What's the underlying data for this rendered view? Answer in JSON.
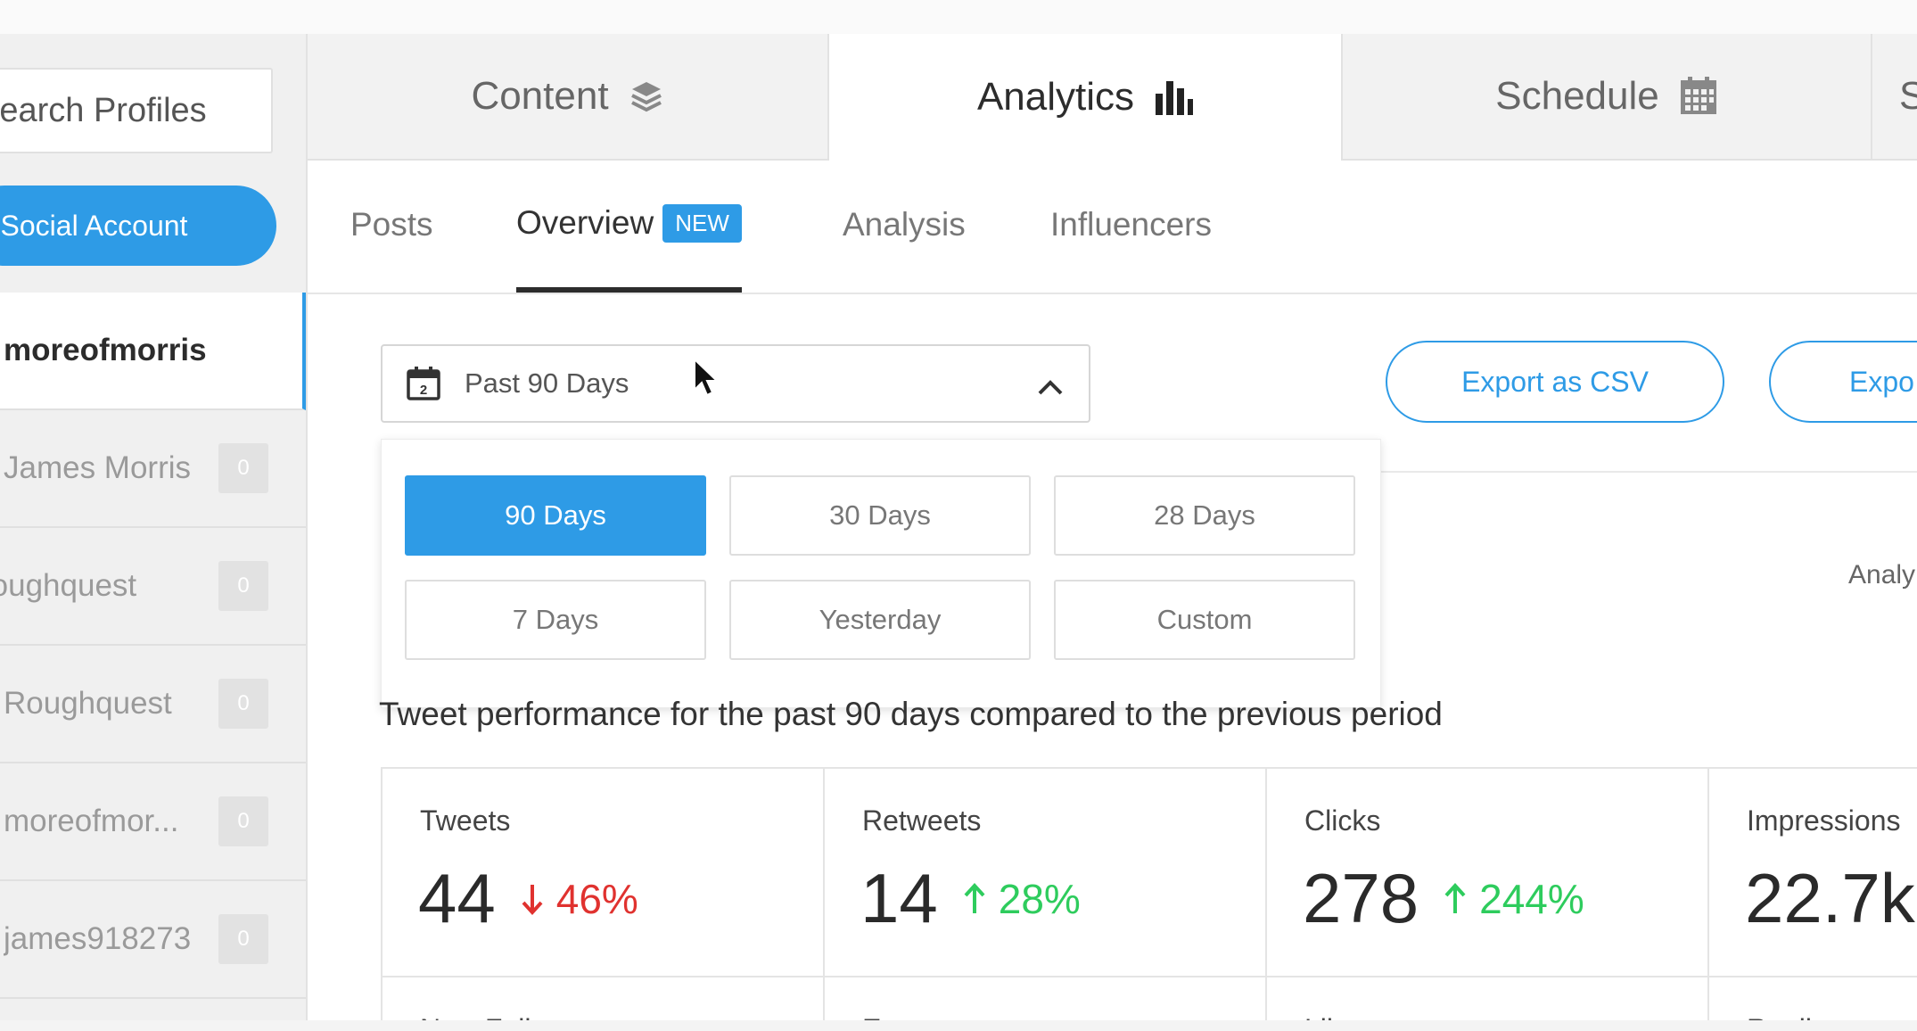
{
  "sidebar": {
    "search_placeholder": "Search Profiles",
    "add_button": "Add a Social Account",
    "profiles": [
      {
        "name": "moreofmorris",
        "badge": ""
      },
      {
        "name": "James Morris",
        "badge": "0"
      },
      {
        "name": "roughquest",
        "badge": "0"
      },
      {
        "name": "Roughquest",
        "badge": "0"
      },
      {
        "name": "moreofmor...",
        "badge": "0"
      },
      {
        "name": "james918273",
        "badge": "0"
      }
    ]
  },
  "topnav": {
    "tabs": [
      {
        "label": "Content",
        "icon": "layers-icon"
      },
      {
        "label": "Analytics",
        "icon": "bar-chart-icon"
      },
      {
        "label": "Schedule",
        "icon": "calendar-grid-icon"
      },
      {
        "label": "S"
      }
    ]
  },
  "subnav": {
    "tabs": [
      "Posts",
      "Overview",
      "Analysis",
      "Influencers"
    ],
    "new_badge": "NEW"
  },
  "date_range": {
    "selected": "Past 90 Days",
    "calendar_day": "2",
    "options": [
      "90 Days",
      "30 Days",
      "28 Days",
      "7 Days",
      "Yesterday",
      "Custom"
    ]
  },
  "export": {
    "csv": "Export as CSV",
    "second": "Expo"
  },
  "analy_label": "Analy",
  "performance_text": "Tweet performance for the past 90 days compared to the previous period",
  "stats": [
    {
      "label": "Tweets",
      "value": "44",
      "delta": "46%",
      "direction": "down"
    },
    {
      "label": "Retweets",
      "value": "14",
      "delta": "28%",
      "direction": "up"
    },
    {
      "label": "Clicks",
      "value": "278",
      "delta": "244%",
      "direction": "up"
    },
    {
      "label": "Impressions",
      "value": "22.7k",
      "delta": "",
      "direction": ""
    }
  ],
  "stats_row2": [
    "New Followers",
    "Engagements",
    "Likes",
    "Replies"
  ],
  "colors": {
    "accent": "#2e9be6",
    "down": "#e0322f",
    "up": "#2ecc5d"
  }
}
